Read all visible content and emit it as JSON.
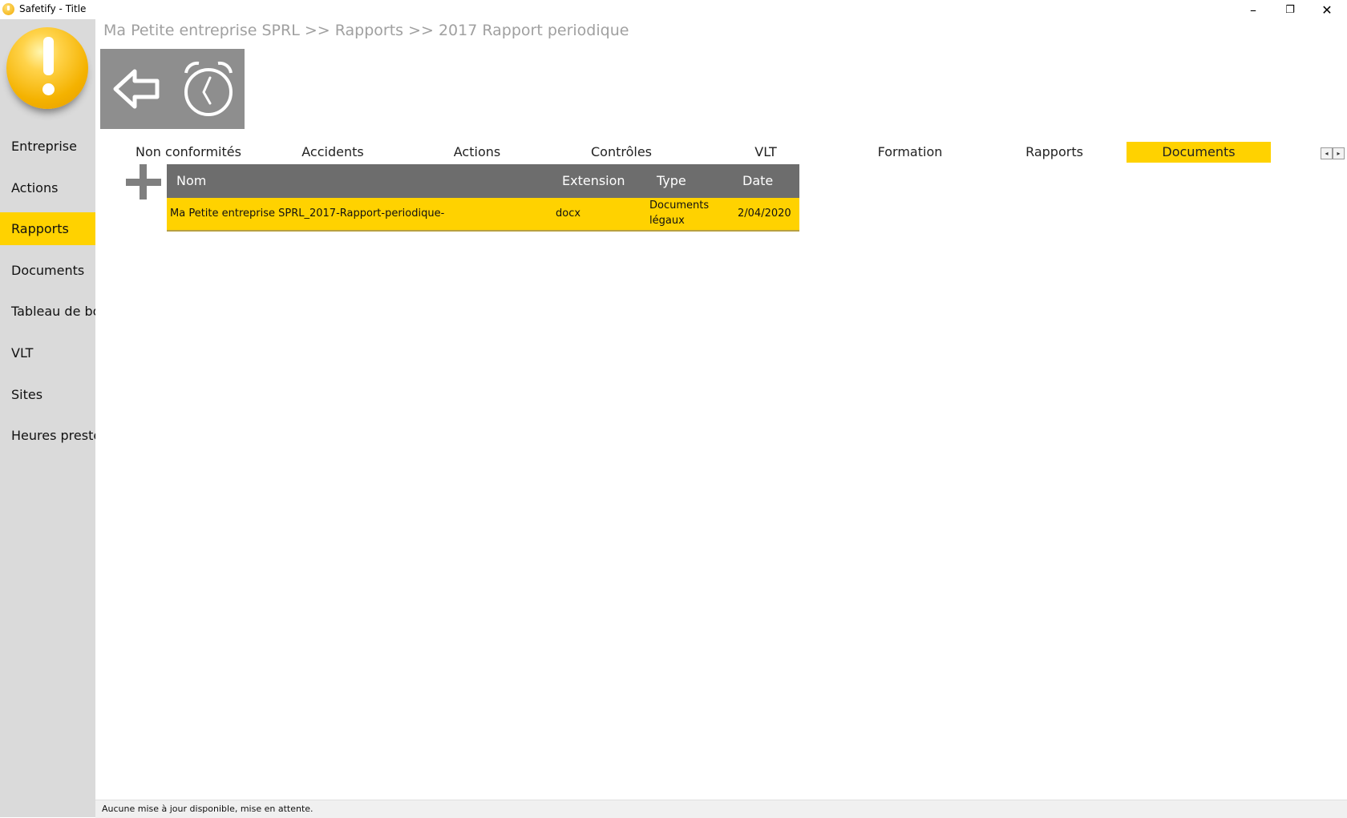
{
  "window": {
    "title": "Safetify - Title",
    "minimize": "–",
    "restore": "❐",
    "close": "✕"
  },
  "sidebar": {
    "items": [
      {
        "label": "Entreprise"
      },
      {
        "label": "Actions"
      },
      {
        "label": "Rapports",
        "active": true
      },
      {
        "label": "Documents"
      },
      {
        "label": "Tableau de bord"
      },
      {
        "label": "VLT"
      },
      {
        "label": "Sites"
      },
      {
        "label": "Heures prestées"
      }
    ]
  },
  "breadcrumb": "Ma Petite entreprise SPRL >> Rapports >> 2017 Rapport periodique",
  "toolbar": {
    "back_icon": "arrow-left-icon",
    "timer_icon": "alarm-clock-icon"
  },
  "tabs": [
    {
      "label": "Non conformités"
    },
    {
      "label": "Accidents"
    },
    {
      "label": "Actions"
    },
    {
      "label": "Contrôles"
    },
    {
      "label": "VLT"
    },
    {
      "label": "Formation"
    },
    {
      "label": "Rapports"
    },
    {
      "label": "Documents",
      "active": true
    }
  ],
  "tab_scroll": {
    "left": "◂",
    "right": "▸"
  },
  "table": {
    "columns": [
      "Nom",
      "Extension",
      "Type",
      "Date"
    ],
    "rows": [
      {
        "nom": "Ma Petite entreprise SPRL_2017-Rapport-periodique-",
        "extension": "docx",
        "type_line1": "Documents",
        "type_line2": "légaux",
        "date": "2/04/2020"
      }
    ]
  },
  "status": "Aucune mise à jour disponible, mise en attente.",
  "colors": {
    "accent": "#ffd200",
    "sidebar_bg": "#dadada",
    "header_bg": "#6d6d6d",
    "toolbar_bg": "#8e8e8e",
    "breadcrumb": "#a0a0a0"
  }
}
